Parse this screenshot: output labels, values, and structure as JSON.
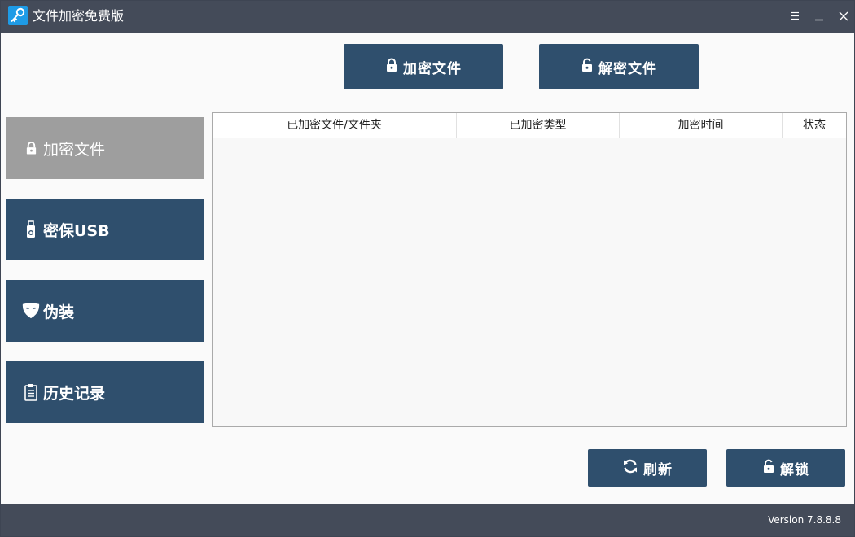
{
  "window": {
    "title": "文件加密免费版",
    "icons": {
      "app": "key-icon",
      "menu": "hamburger-icon",
      "minimize": "minimize-icon",
      "close": "close-icon"
    }
  },
  "toolbar": {
    "encrypt_label": "加密文件",
    "decrypt_label": "解密文件"
  },
  "sidebar": {
    "items": [
      {
        "label": "加密文件",
        "icon": "lock-icon",
        "active": true
      },
      {
        "label": "密保USB",
        "icon": "usb-icon",
        "active": false
      },
      {
        "label": "伪装",
        "icon": "mask-icon",
        "active": false
      },
      {
        "label": "历史记录",
        "icon": "clipboard-icon",
        "active": false
      }
    ]
  },
  "table": {
    "columns": [
      "已加密文件/文件夹",
      "已加密类型",
      "加密时间",
      "状态"
    ],
    "rows": []
  },
  "actions": {
    "refresh_label": "刷新",
    "unlock_label": "解锁"
  },
  "status": {
    "version": "Version 7.8.8.8"
  },
  "colors": {
    "titlebar": "#444b59",
    "button": "#2f4f6d",
    "active_tab": "#9e9e9e",
    "background": "#fafafa"
  }
}
